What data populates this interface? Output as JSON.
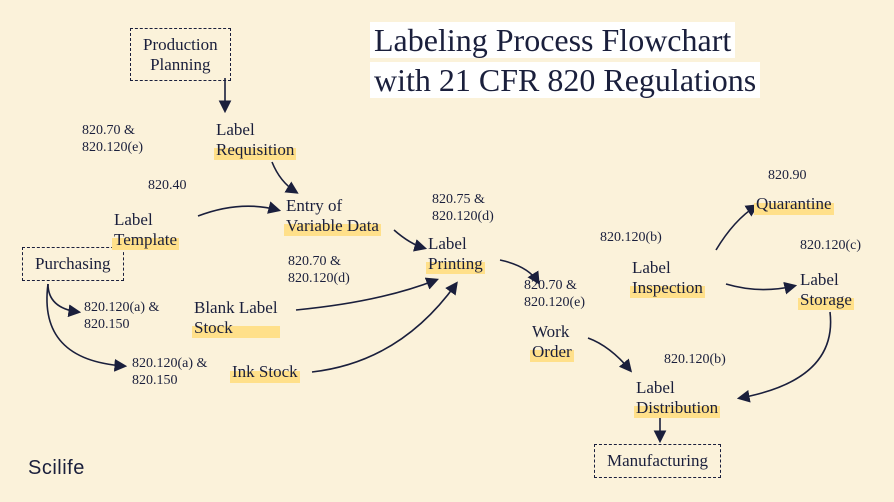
{
  "title_line1": "Labeling Process Flowchart",
  "title_line2": "with 21 CFR 820 Regulations",
  "logo": "Scilife",
  "dashed_nodes": {
    "production_planning": "Production\nPlanning",
    "purchasing": "Purchasing",
    "manufacturing": "Manufacturing"
  },
  "nodes": {
    "label_requisition": "Label\nRequisition",
    "label_template": "Label\nTemplate",
    "entry_variable_data": "Entry of\nVariable Data",
    "blank_label_stock": "Blank Label\nStock",
    "ink_stock": "Ink Stock",
    "label_printing": "Label\nPrinting",
    "work_order": "Work\nOrder",
    "label_inspection": "Label\nInspection",
    "quarantine": "Quarantine",
    "label_storage": "Label\nStorage",
    "label_distribution": "Label\nDistribution"
  },
  "refs": {
    "r1": "820.70 &\n820.120(e)",
    "r2": "820.40",
    "r3": "820.120(a) &\n820.150",
    "r4": "820.120(a) &\n820.150",
    "r5": "820.70 &\n820.120(d)",
    "r6": "820.75 &\n820.120(d)",
    "r7": "820.70 &\n820.120(e)",
    "r8": "820.120(b)",
    "r9": "820.90",
    "r10": "820.120(c)",
    "r11": "820.120(b)"
  }
}
